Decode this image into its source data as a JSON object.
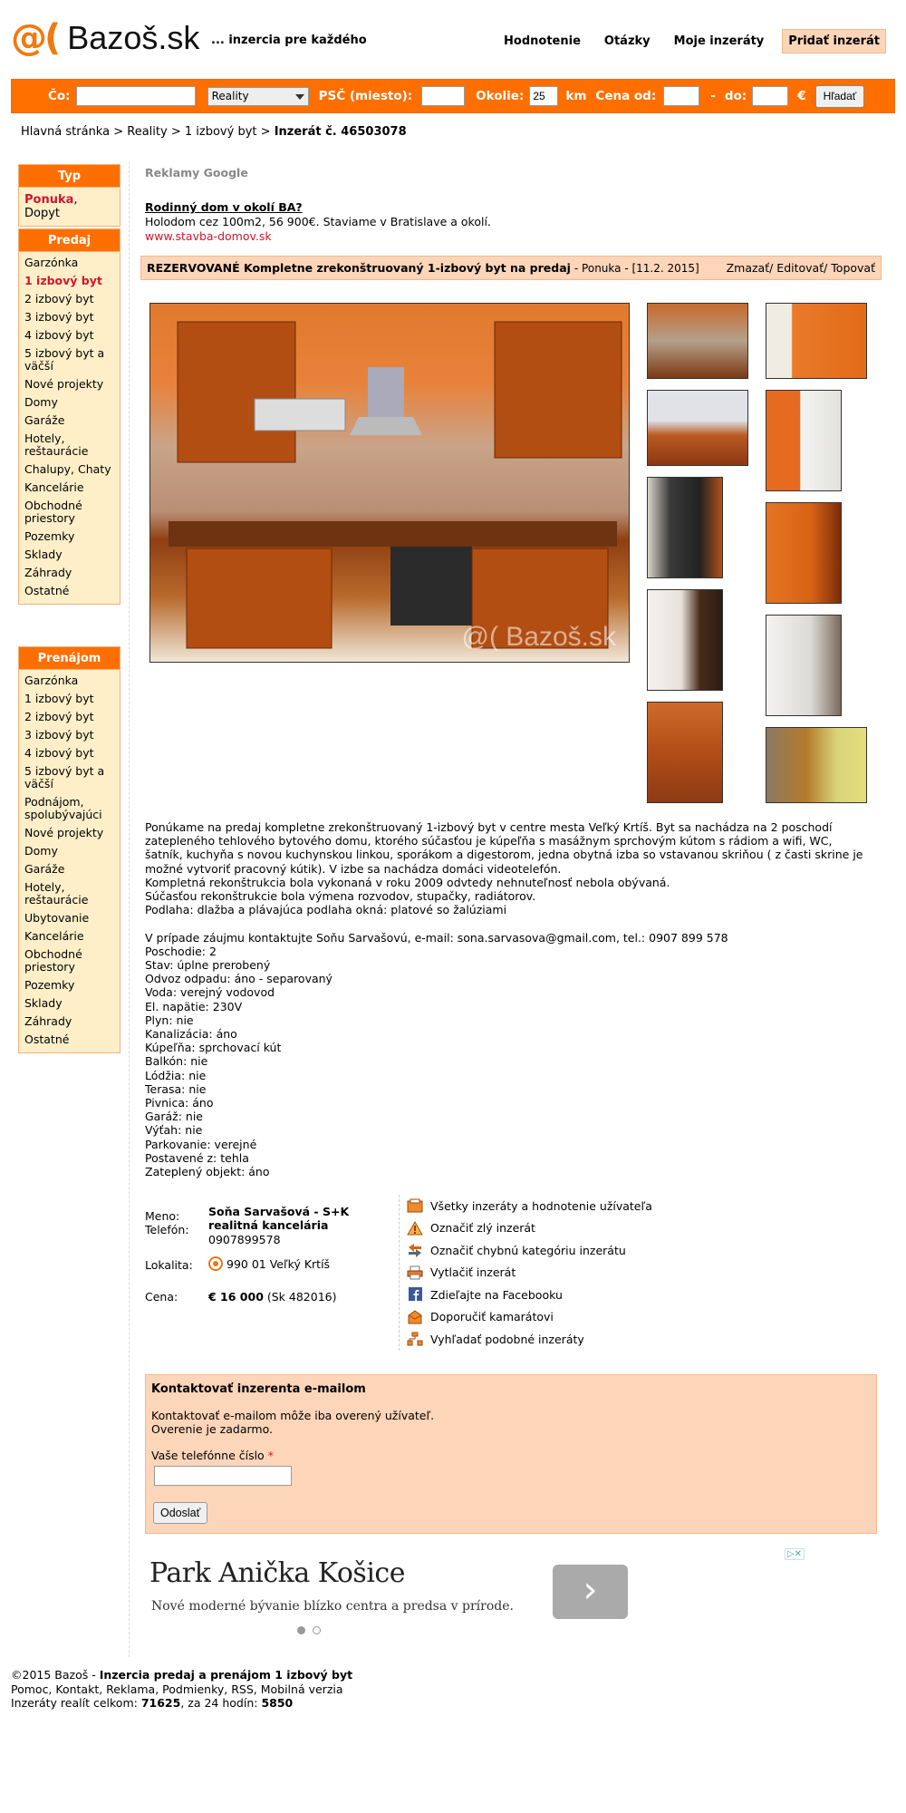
{
  "header": {
    "logo_text": "Bazoš.sk",
    "slogan": "... inzercia pre každého",
    "nav": [
      "Hodnotenie",
      "Otázky",
      "Moje inzeráty"
    ],
    "add_label": "Pridať inzerát"
  },
  "search": {
    "what_label": "Čo:",
    "what_value": "",
    "category_selected": "Reality",
    "psc_label": "PSČ (miesto):",
    "psc_value": "",
    "radius_label": "Okolie:",
    "radius_value": "25",
    "radius_unit": "km",
    "price_from_label": "Cena od:",
    "price_from_value": "",
    "price_to_label": "do:",
    "price_to_value": "",
    "dash": "-",
    "currency": "€",
    "submit_label": "Hľadať"
  },
  "breadcrumb": {
    "items": [
      "Hlavná stránka",
      "Reality",
      "1 izbový byt"
    ],
    "sep": ">",
    "current": "Inzerát č. 46503078"
  },
  "sidebar": {
    "type": {
      "title": "Typ",
      "offer": "Ponuka",
      "comma": ",",
      "demand": "Dopyt"
    },
    "sale": {
      "title": "Predaj",
      "items": [
        "Garzónka",
        "1 izbový byt",
        "2 izbový byt",
        "3 izbový byt",
        "4 izbový byt",
        "5 izbový byt a väčší",
        "Nové projekty",
        "Domy",
        "Garáže",
        "Hotely, reštaurácie",
        "Chalupy, Chaty",
        "Kancelárie",
        "Obchodné priestory",
        "Pozemky",
        "Sklady",
        "Záhrady",
        "Ostatné"
      ]
    },
    "rent": {
      "title": "Prenájom",
      "items": [
        "Garzónka",
        "1 izbový byt",
        "2 izbový byt",
        "3 izbový byt",
        "4 izbový byt",
        "5 izbový byt a väčší",
        "Podnájom, spolubývajúci",
        "Nové projekty",
        "Domy",
        "Garáže",
        "Hotely, reštaurácie",
        "Ubytovanie",
        "Kancelárie",
        "Obchodné priestory",
        "Pozemky",
        "Sklady",
        "Záhrady",
        "Ostatné"
      ]
    }
  },
  "google_ads": {
    "label": "Reklamy Google",
    "title": "Rodinný dom v okolí BA?",
    "text": "Holodom cez 100m2, 56 900€. Staviame v Bratislave a okolí.",
    "url": "www.stavba-domov.sk"
  },
  "listing": {
    "title": "REZERVOVANÉ Kompletne zrekonštruovaný 1-izbový byt na predaj",
    "meta": "- Ponuka - [11.2. 2015]",
    "actions": "Zmazať/ Editovať/ Topovať",
    "watermark": "@( Bazoš.sk",
    "description": "Ponúkame na predaj kompletne zrekonštruovaný 1-izbový byt v centre mesta Veľký Krtíš. Byt sa nachádza na 2 poschodí zatepleného tehlového bytového domu, ktorého súčasťou je kúpeľňa s masážnym sprchovým kútom s rádiom a wifi, WC, šatník, kuchyňa s novou kuchynskou linkou, sporákom a digestorom, jedna obytná izba so vstavanou skriňou ( z časti skrine je možné vytvoriť pracovný kútik). V izbe sa nachádza domáci videotelefón.\nKompletná rekonštrukcia bola vykonaná v roku 2009 odvtedy nehnuteľnosť nebola obývaná.\nSúčasťou rekonštrukcie bola výmena rozvodov, stupačky, radiátorov.\nPodlaha: dlažba a plávajúca podlaha okná: platové so žalúziami\n\nV prípade záujmu kontaktujte Soňu Sarvašovú, e-mail: sona.sarvasova@gmail.com, tel.: 0907 899 578\nPoschodie: 2\nStav: úplne prerobený\nOdvoz odpadu: áno - separovaný\nVoda: verejný vodovod\nEl. napätie: 230V\nPlyn: nie\nKanalizácia: áno\nKúpeľňa: sprchovací kút\nBalkón: nie\nLódžia: nie\nTerasa: nie\nPivnica: áno\nGaráž: nie\nVýťah: nie\nParkovanie: verejné\nPostavené z: tehla\nZateplený objekt: áno"
  },
  "seller": {
    "name_label": "Meno:",
    "phone_label": "Telefón:",
    "name": "Soňa Sarvašová - S+K realitná kancelária",
    "phone": "0907899578",
    "location_label": "Lokalita:",
    "location": "990 01 Veľký Krtíš",
    "price_label": "Cena:",
    "price": "€ 16 000",
    "price_sk": "(Sk 482016)"
  },
  "actions": [
    {
      "label": "Všetky inzeráty a hodnotenie užívateľa",
      "icon": "user-listings-icon"
    },
    {
      "label": "Označiť zlý inzerát",
      "icon": "warning-icon"
    },
    {
      "label": "Označiť chybnú kategóriu inzerátu",
      "icon": "swap-arrows-icon"
    },
    {
      "label": "Vytlačiť inzerát",
      "icon": "printer-icon"
    },
    {
      "label": "Zdieľajte na Facebooku",
      "icon": "facebook-icon"
    },
    {
      "label": "Doporučiť kamarátovi",
      "icon": "recommend-icon"
    },
    {
      "label": "Vyhľadať podobné inzeráty",
      "icon": "similar-icon"
    }
  ],
  "contact_form": {
    "title": "Kontaktovať inzerenta e-mailom",
    "note1": "Kontaktovať e-mailom môže iba overený užívateľ.",
    "note2": "Overenie je zadarmo.",
    "phone_label": "Vaše telefónne číslo",
    "required_mark": "*",
    "phone_value": "",
    "submit_label": "Odoslať"
  },
  "display_ad": {
    "title": "Park Anička Košice",
    "subtitle": "Nové moderné bývanie blízko centra a predsa v prírode."
  },
  "footer": {
    "copyright": "©2015 Bazoš -",
    "tagline": "Inzercia predaj a prenájom 1 izbový byt",
    "links": "Pomoc, Kontakt, Reklama, Podmienky, RSS, Mobilná verzia",
    "stats_prefix": "Inzeráty realít celkom:",
    "total": "71625",
    "stats_mid": ", za 24 hodín:",
    "day": "5850"
  },
  "colors": {
    "accent": "#ff6f00",
    "panel": "#ffefc9",
    "title_bg": "#fdd5b9",
    "link_red": "#d1152d"
  }
}
